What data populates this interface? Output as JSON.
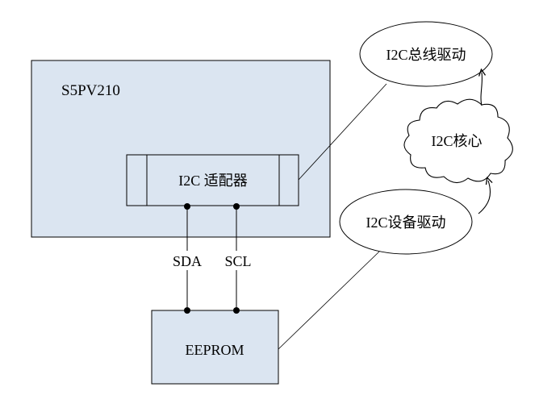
{
  "soc": {
    "label": "S5PV210"
  },
  "adapter": {
    "label": "I2C 适配器"
  },
  "signals": {
    "sda": "SDA",
    "scl": "SCL"
  },
  "eeprom": {
    "label": "EEPROM"
  },
  "bus_driver": {
    "label": "I2C总线驱动"
  },
  "core": {
    "label": "I2C核心"
  },
  "device_driver": {
    "label": "I2C设备驱动"
  },
  "colors": {
    "box_fill": "#dbe5f1",
    "stroke": "#000000",
    "ellipse_fill": "#ffffff"
  }
}
